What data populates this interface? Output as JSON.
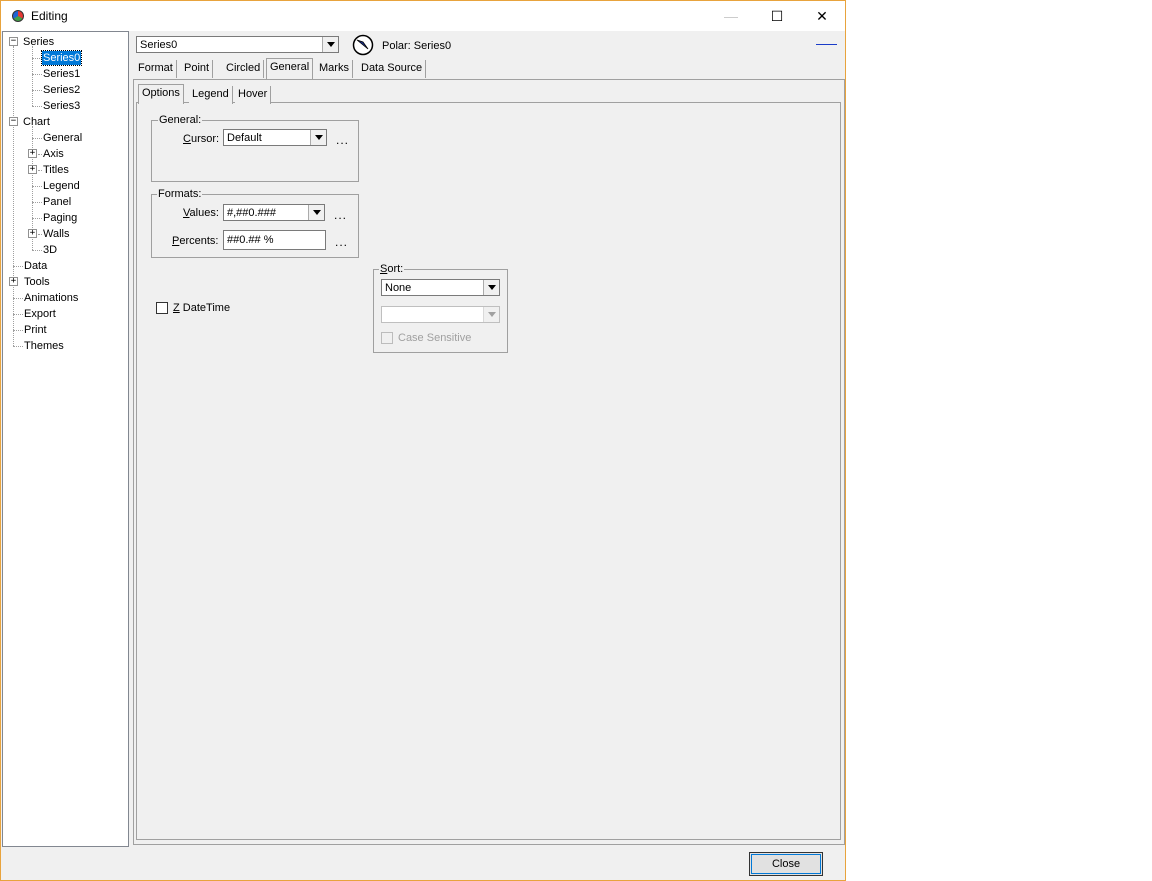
{
  "window": {
    "title": "Editing",
    "minimize_symbol": "—",
    "maximize_symbol": "☐",
    "close_symbol": "✕"
  },
  "tree": {
    "series_root": "Series",
    "series": [
      "Series0",
      "Series1",
      "Series2",
      "Series3"
    ],
    "chart_root": "Chart",
    "chart_children": [
      "General",
      "Axis",
      "Titles",
      "Legend",
      "Panel",
      "Paging",
      "Walls",
      "3D"
    ],
    "roots": [
      "Data",
      "Tools",
      "Animations",
      "Export",
      "Print",
      "Themes"
    ],
    "expanded_symbol": "−",
    "collapsed_symbol": "+"
  },
  "header": {
    "series_select": "Series0",
    "series_caption": "Polar: Series0",
    "line_color": "#1a3cc8"
  },
  "tabs": {
    "main": [
      "Format",
      "Point",
      "Circled",
      "General",
      "Marks",
      "Data Source"
    ],
    "main_active": "General",
    "sub": [
      "Options",
      "Legend",
      "Hover"
    ],
    "sub_active": "Options"
  },
  "general_group": {
    "title": "General:",
    "cursor_label_prefix": "C",
    "cursor_label_rest": "ursor:",
    "cursor_value": "Default",
    "ellipsis": "..."
  },
  "formats_group": {
    "title": "Formats:",
    "values_label_prefix": "V",
    "values_label_rest": "alues:",
    "values_value": "#,##0.###",
    "percents_label_prefix": "P",
    "percents_label_rest": "ercents:",
    "percents_value": "##0.## %",
    "ellipsis": "..."
  },
  "zdatetime": {
    "label_prefix": "Z",
    "label_rest": " DateTime",
    "checked": false
  },
  "sort_group": {
    "title_prefix": "S",
    "title_rest": "ort:",
    "sort_value": "None",
    "field_value": "",
    "case_label": "Case Sensitive"
  },
  "footer": {
    "close_label": "Close"
  }
}
